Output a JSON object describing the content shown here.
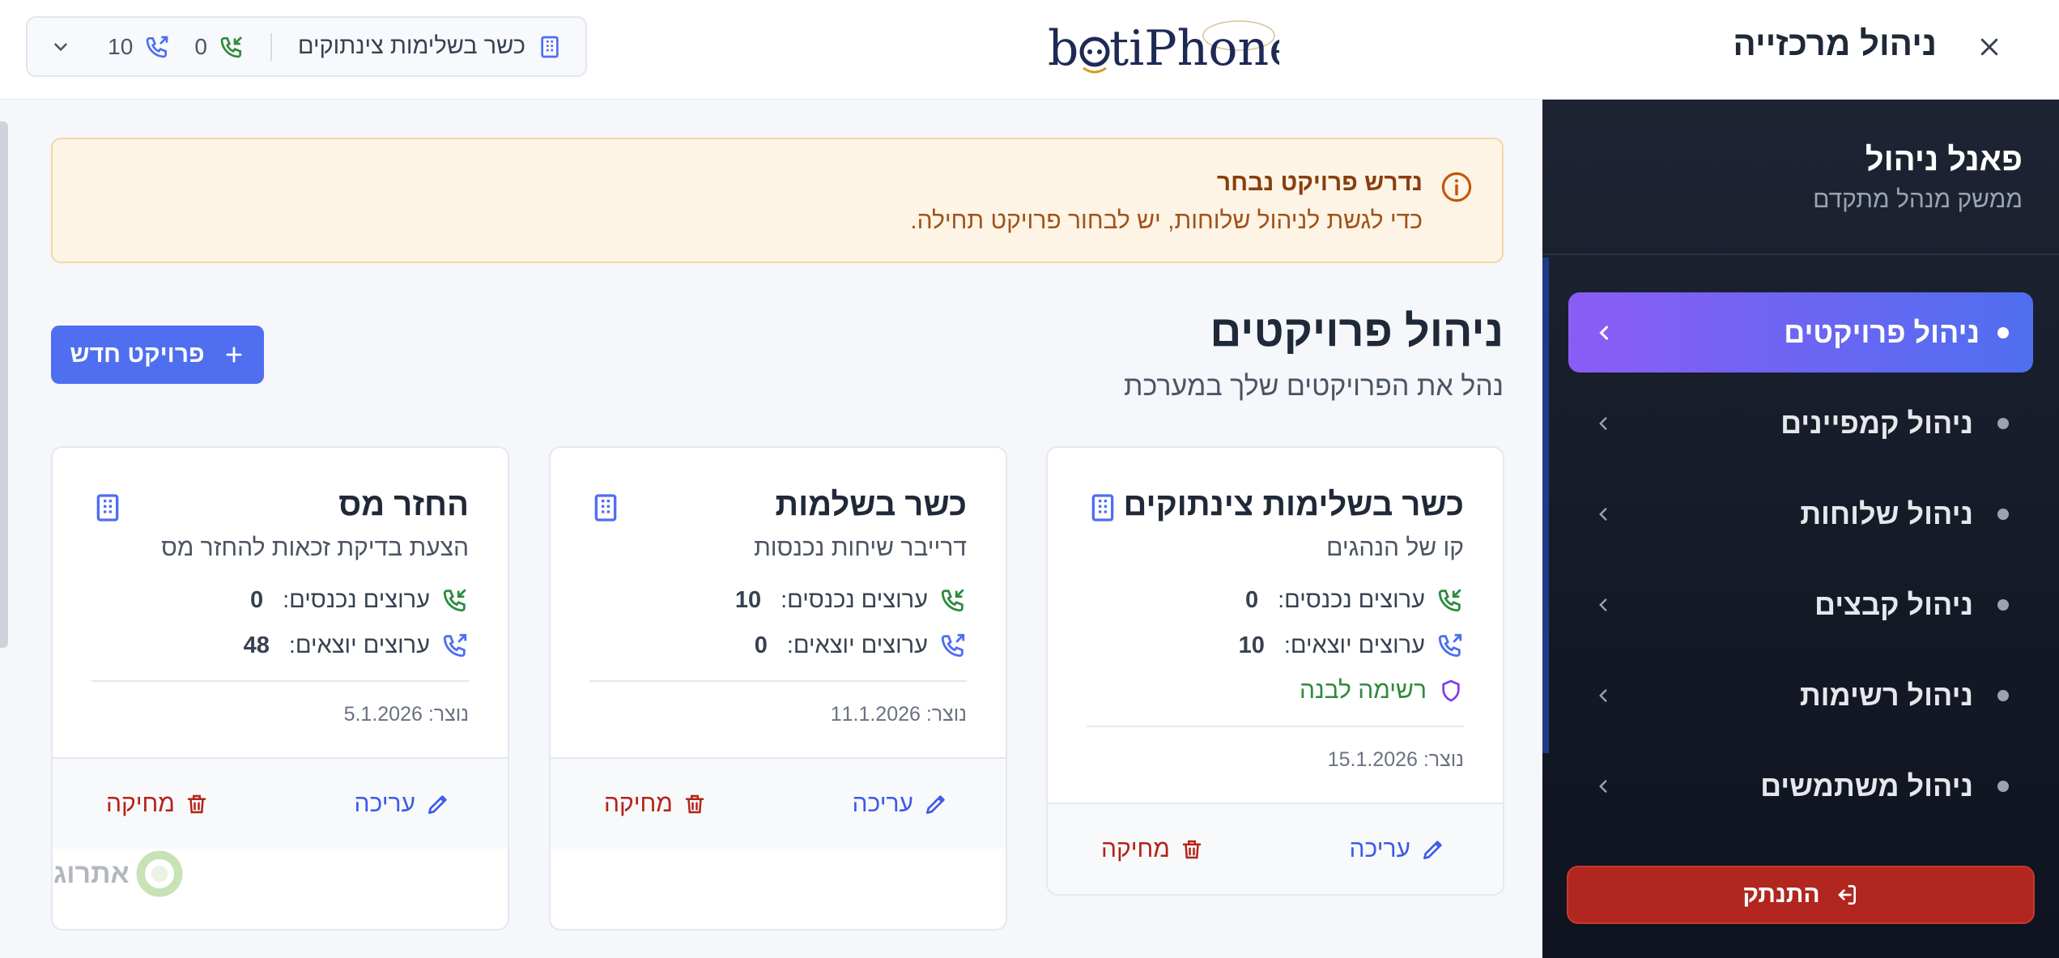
{
  "topbar": {
    "title": "ניהול מרכזייה",
    "brand": "botiPhone",
    "project_name": "כשר בשלימות צינתוקים",
    "incoming_count": "0",
    "outgoing_count": "10"
  },
  "sidebar": {
    "title": "פאנל ניהול",
    "subtitle": "ממשק מנהל מתקדם",
    "items": [
      {
        "label": "ניהול פרויקטים",
        "active": true
      },
      {
        "label": "ניהול קמפיינים",
        "active": false
      },
      {
        "label": "ניהול שלוחות",
        "active": false
      },
      {
        "label": "ניהול קבצים",
        "active": false
      },
      {
        "label": "ניהול רשימות",
        "active": false
      },
      {
        "label": "ניהול משתמשים",
        "active": false
      }
    ],
    "logout_label": "התנתק"
  },
  "alert": {
    "title": "נדרש פרויקט נבחר",
    "text": "כדי לגשת לניהול שלוחות, יש לבחור פרויקט תחילה."
  },
  "main": {
    "title": "ניהול פרויקטים",
    "subtitle": "נהל את הפרויקטים שלך במערכת",
    "new_button": "פרויקט חדש",
    "incoming_label": "ערוצים נכנסים:",
    "outgoing_label": "ערוצים יוצאים:",
    "edit_label": "עריכה",
    "delete_label": "מחיקה",
    "cards": [
      {
        "name": "כשר בשלימות צינתוקים",
        "desc": "קו של הנהגים",
        "incoming": "0",
        "outgoing": "10",
        "whitelist": "רשימה לבנה",
        "created": "נוצר: 15.1.2026"
      },
      {
        "name": "כשר בשלמות",
        "desc": "דרייבר שיחות נכנסות",
        "incoming": "10",
        "outgoing": "0",
        "created": "נוצר: 11.1.2026"
      },
      {
        "name": "החזר מס",
        "desc": "הצעת בדיקת זכאות להחזר מס",
        "incoming": "0",
        "outgoing": "48",
        "created": "נוצר: 5.1.2026"
      }
    ]
  },
  "watermark": "אתרוג",
  "colors": {
    "accent": "#4f6ef0",
    "sidebar_bg": "#141926",
    "logout": "#b1261e",
    "alert_bg": "#fdf4e5",
    "success": "#2e8b3e"
  }
}
